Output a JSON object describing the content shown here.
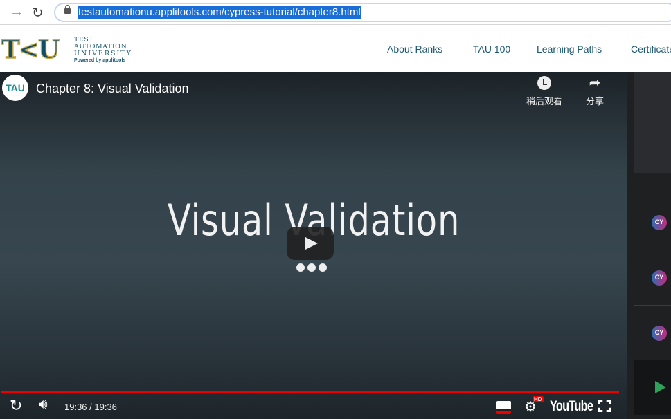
{
  "browser": {
    "url": "testautomationu.applitools.com/cypress-tutorial/chapter8.html"
  },
  "header": {
    "logo_letters": "TAU",
    "logo_line1": "TEST",
    "logo_line2": "AUTOMATION",
    "logo_line3": "UNIVERSITY",
    "logo_powered": "Powered by applitools",
    "menu": [
      {
        "label": "About Ranks"
      },
      {
        "label": "TAU 100"
      },
      {
        "label": "Learning Paths"
      },
      {
        "label": "Certificates"
      }
    ]
  },
  "video": {
    "channel_avatar": "TAU",
    "title": "Chapter 8: Visual Validation",
    "watch_later": "稍后观看",
    "share": "分享",
    "slide_title": "Visual Validation",
    "time": "19:36 / 19:36",
    "progress_percent": 100,
    "brand": "YouTube",
    "hd_badge": "HD"
  },
  "sidebar": {
    "badge_label": "CY"
  },
  "colors": {
    "accent": "#e00000",
    "brand": "#1b5873",
    "play_green": "#2fa15a"
  }
}
